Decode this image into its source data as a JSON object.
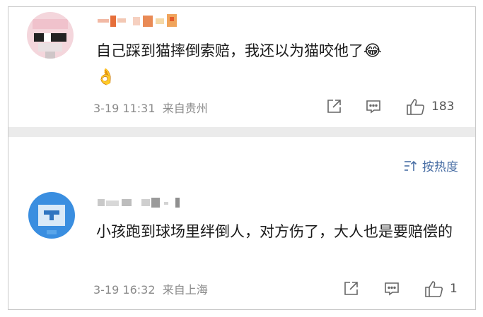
{
  "comments": [
    {
      "username": "·一·十 ·",
      "text": "自己踩到猫摔倒索赔，我还以为猫咬他了",
      "emoji_end": "😂",
      "emoji_line2": "👌",
      "time": "3-19 11:31",
      "location": "来自贵州",
      "likes": "183"
    },
    {
      "username": "Idim  n·l ·  ·",
      "text": "小孩跑到球场里绊倒人，对方伤了，大人也是要赔偿的",
      "time": "3-19 16:32",
      "location": "来自上海",
      "likes": "1"
    }
  ],
  "sort": {
    "label": "按热度"
  },
  "icons": [
    "share-icon",
    "comment-icon",
    "like-icon",
    "sort-icon"
  ],
  "colors": {
    "accent": "#4a6fa5",
    "meta": "#8a8a8a",
    "divider": "#ebebeb"
  }
}
